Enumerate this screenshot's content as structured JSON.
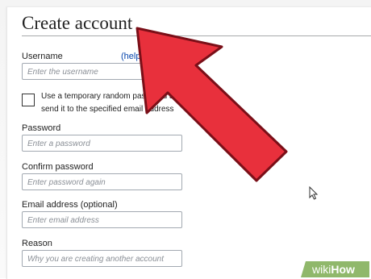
{
  "form": {
    "title": "Create account",
    "username": {
      "label": "Username",
      "help_link": "(help me",
      "placeholder": "Enter the username"
    },
    "temp_password": {
      "line1": "Use a temporary random password a",
      "line2": "send it to the specified email address"
    },
    "password": {
      "label": "Password",
      "placeholder": "Enter a password"
    },
    "confirm_password": {
      "label": "Confirm password",
      "placeholder": "Enter password again"
    },
    "email": {
      "label": "Email address (optional)",
      "placeholder": "Enter email address"
    },
    "reason": {
      "label": "Reason",
      "placeholder": "Why you are creating another account"
    }
  },
  "overlay": {
    "arrow_icon": "red-arrow-icon",
    "arrow_color": "#e8303c",
    "cursor_icon": "mouse-cursor-icon"
  },
  "watermark": {
    "text": "wikiHow",
    "prefix": "wiki",
    "suffix": "How",
    "bg_color": "#8ab463"
  }
}
